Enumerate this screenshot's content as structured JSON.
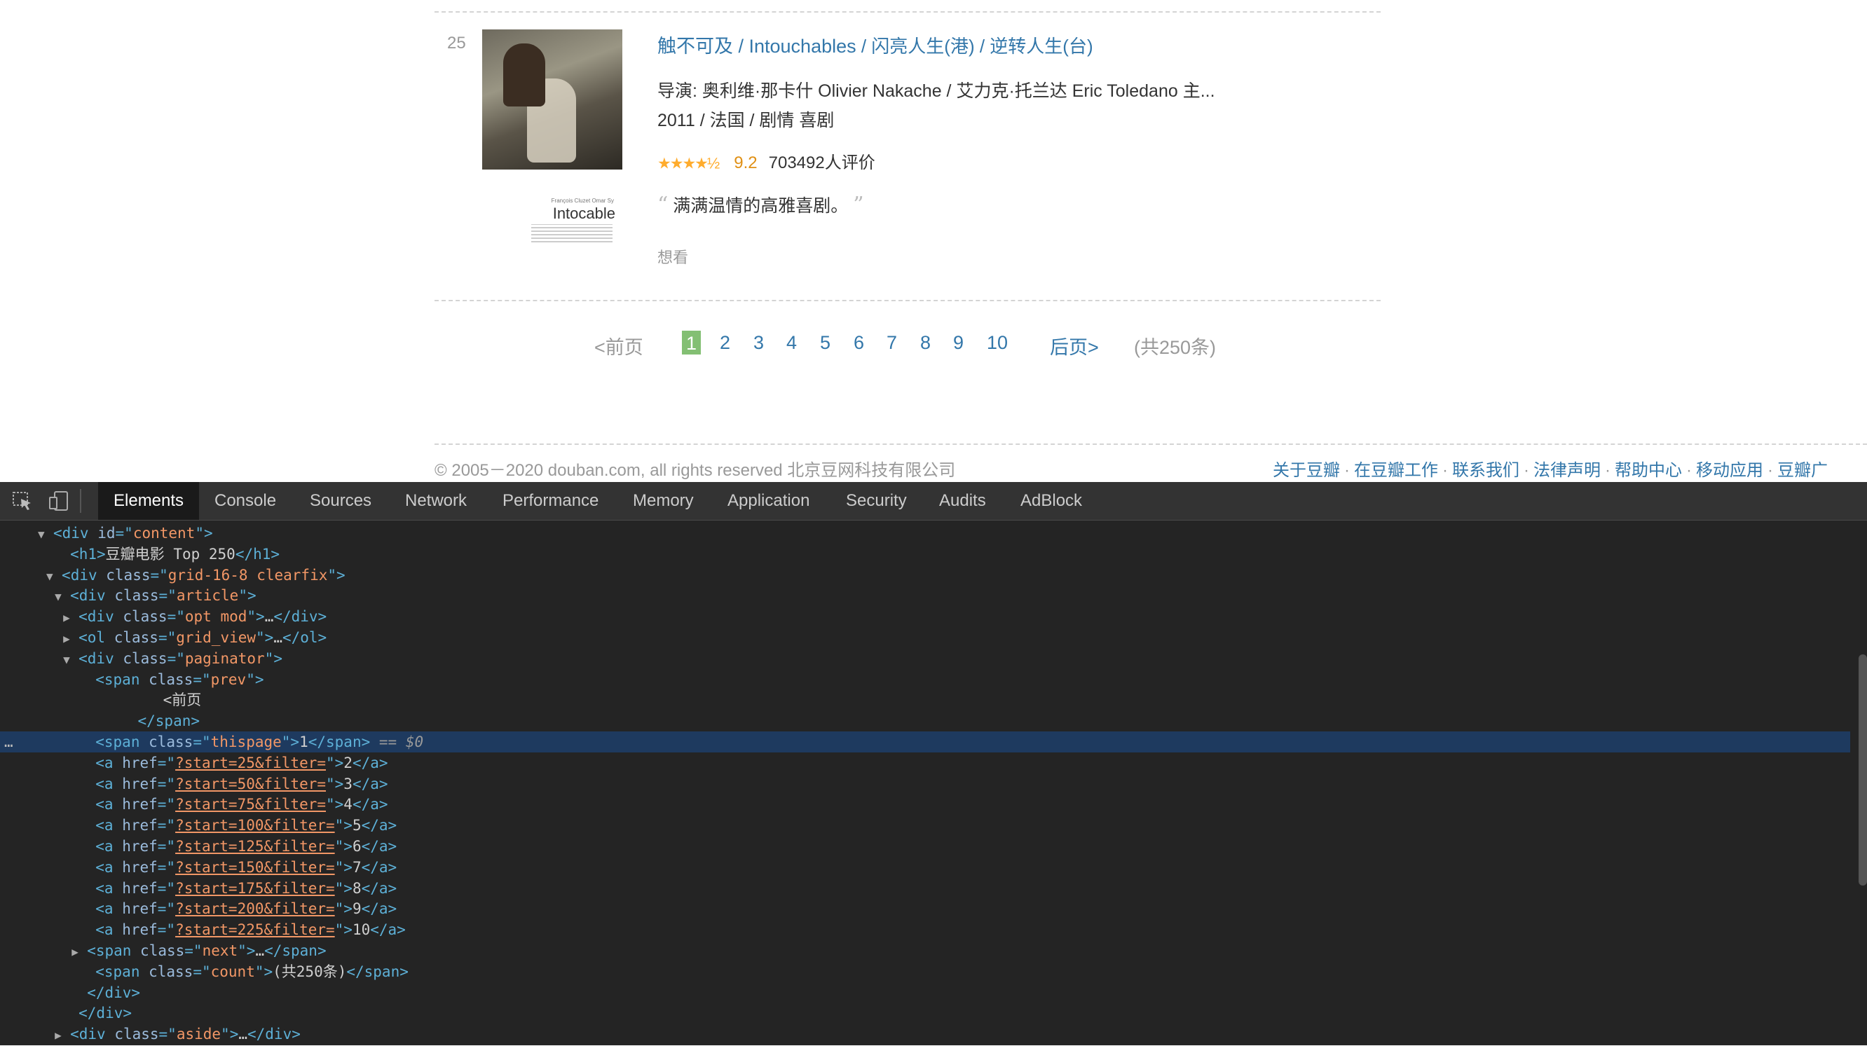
{
  "movie": {
    "rank": "25",
    "title": "触不可及",
    "title_original": " / Intouchables",
    "title_alt": " / 闪亮人生(港) / 逆转人生(台)",
    "director_line": "导演: 奥利维·那卡什 Olivier Nakache / 艾力克·托兰达 Eric Toledano   主...",
    "meta_line": "2011 / 法国 / 剧情 喜剧",
    "stars": "★★★★½",
    "rating": "9.2",
    "votes": "703492人评价",
    "quote": "满满温情的高雅喜剧。",
    "quote_open": "“",
    "quote_close": "”",
    "want": "想看",
    "poster_brand": "Intocable",
    "poster_credit": "François Cluzet  Omar Sy"
  },
  "paginator": {
    "prev": "<前页",
    "pages": [
      "1",
      "2",
      "3",
      "4",
      "5",
      "6",
      "7",
      "8",
      "9",
      "10"
    ],
    "next": "后页>",
    "count": "(共250条)"
  },
  "footer": {
    "copyright": "© 2005－2020 douban.com, all rights reserved 北京豆网科技有限公司",
    "links": [
      "关于豆瓣",
      "在豆瓣工作",
      "联系我们",
      "法律声明",
      "帮助中心",
      "移动应用",
      "豆瓣广"
    ]
  },
  "devtools": {
    "tabs": [
      "Elements",
      "Console",
      "Sources",
      "Network",
      "Performance",
      "Memory",
      "Application",
      "Security",
      "Audits",
      "AdBlock"
    ],
    "active_tab": "Elements",
    "lines": [
      {
        "indent": 4,
        "tri": "▼",
        "parts": [
          [
            "tg",
            "<div "
          ],
          [
            "at",
            "id"
          ],
          [
            "tg",
            "=\""
          ],
          [
            "av",
            "content"
          ],
          [
            "tg",
            "\">"
          ]
        ]
      },
      {
        "indent": 6,
        "tri": "",
        "parts": [
          [
            "tg",
            "<h1>"
          ],
          [
            "tx",
            "豆瓣电影 Top 250"
          ],
          [
            "tg",
            "</h1>"
          ]
        ]
      },
      {
        "indent": 5,
        "tri": "▼",
        "parts": [
          [
            "tg",
            "<div "
          ],
          [
            "at",
            "class"
          ],
          [
            "tg",
            "=\""
          ],
          [
            "av",
            "grid-16-8 clearfix"
          ],
          [
            "tg",
            "\">"
          ]
        ]
      },
      {
        "indent": 6,
        "tri": "▼",
        "parts": [
          [
            "tg",
            "<div "
          ],
          [
            "at",
            "class"
          ],
          [
            "tg",
            "=\""
          ],
          [
            "av",
            "article"
          ],
          [
            "tg",
            "\">"
          ]
        ]
      },
      {
        "indent": 7,
        "tri": "▶",
        "parts": [
          [
            "tg",
            "<div "
          ],
          [
            "at",
            "class"
          ],
          [
            "tg",
            "=\""
          ],
          [
            "av",
            "opt mod"
          ],
          [
            "tg",
            "\">"
          ],
          [
            "tx",
            "…"
          ],
          [
            "tg",
            "</div>"
          ]
        ]
      },
      {
        "indent": 7,
        "tri": "▶",
        "parts": [
          [
            "tg",
            "<ol "
          ],
          [
            "at",
            "class"
          ],
          [
            "tg",
            "=\""
          ],
          [
            "av",
            "grid_view"
          ],
          [
            "tg",
            "\">"
          ],
          [
            "tx",
            "…"
          ],
          [
            "tg",
            "</ol>"
          ]
        ]
      },
      {
        "indent": 7,
        "tri": "▼",
        "parts": [
          [
            "tg",
            "<div "
          ],
          [
            "at",
            "class"
          ],
          [
            "tg",
            "=\""
          ],
          [
            "av",
            "paginator"
          ],
          [
            "tg",
            "\">"
          ]
        ]
      },
      {
        "indent": 9,
        "tri": "",
        "parts": [
          [
            "tg",
            "<span "
          ],
          [
            "at",
            "class"
          ],
          [
            "tg",
            "=\""
          ],
          [
            "av",
            "prev"
          ],
          [
            "tg",
            "\">"
          ]
        ]
      },
      {
        "indent": 17,
        "tri": "",
        "parts": [
          [
            "tx",
            "<前页"
          ]
        ]
      },
      {
        "indent": 14,
        "tri": "",
        "parts": [
          [
            "tg",
            "</span>"
          ]
        ]
      },
      {
        "indent": 9,
        "tri": "",
        "sel": true,
        "parts": [
          [
            "tg",
            "<span "
          ],
          [
            "at",
            "class"
          ],
          [
            "tg",
            "=\""
          ],
          [
            "av",
            "thispage"
          ],
          [
            "tg",
            "\">"
          ],
          [
            "tx",
            "1"
          ],
          [
            "tg",
            "</span>"
          ],
          [
            "dim",
            " == $0"
          ]
        ]
      },
      {
        "indent": 9,
        "tri": "",
        "parts": [
          [
            "tg",
            "<a "
          ],
          [
            "at",
            "href"
          ],
          [
            "tg",
            "=\""
          ],
          [
            "av",
            "?start=25&filter="
          ],
          [
            "tg",
            "\">"
          ],
          [
            "tx",
            "2"
          ],
          [
            "tg",
            "</a>"
          ]
        ]
      },
      {
        "indent": 9,
        "tri": "",
        "parts": [
          [
            "tg",
            "<a "
          ],
          [
            "at",
            "href"
          ],
          [
            "tg",
            "=\""
          ],
          [
            "av",
            "?start=50&filter="
          ],
          [
            "tg",
            "\">"
          ],
          [
            "tx",
            "3"
          ],
          [
            "tg",
            "</a>"
          ]
        ]
      },
      {
        "indent": 9,
        "tri": "",
        "parts": [
          [
            "tg",
            "<a "
          ],
          [
            "at",
            "href"
          ],
          [
            "tg",
            "=\""
          ],
          [
            "av",
            "?start=75&filter="
          ],
          [
            "tg",
            "\">"
          ],
          [
            "tx",
            "4"
          ],
          [
            "tg",
            "</a>"
          ]
        ]
      },
      {
        "indent": 9,
        "tri": "",
        "parts": [
          [
            "tg",
            "<a "
          ],
          [
            "at",
            "href"
          ],
          [
            "tg",
            "=\""
          ],
          [
            "av",
            "?start=100&filter="
          ],
          [
            "tg",
            "\">"
          ],
          [
            "tx",
            "5"
          ],
          [
            "tg",
            "</a>"
          ]
        ]
      },
      {
        "indent": 9,
        "tri": "",
        "parts": [
          [
            "tg",
            "<a "
          ],
          [
            "at",
            "href"
          ],
          [
            "tg",
            "=\""
          ],
          [
            "av",
            "?start=125&filter="
          ],
          [
            "tg",
            "\">"
          ],
          [
            "tx",
            "6"
          ],
          [
            "tg",
            "</a>"
          ]
        ]
      },
      {
        "indent": 9,
        "tri": "",
        "parts": [
          [
            "tg",
            "<a "
          ],
          [
            "at",
            "href"
          ],
          [
            "tg",
            "=\""
          ],
          [
            "av",
            "?start=150&filter="
          ],
          [
            "tg",
            "\">"
          ],
          [
            "tx",
            "7"
          ],
          [
            "tg",
            "</a>"
          ]
        ]
      },
      {
        "indent": 9,
        "tri": "",
        "parts": [
          [
            "tg",
            "<a "
          ],
          [
            "at",
            "href"
          ],
          [
            "tg",
            "=\""
          ],
          [
            "av",
            "?start=175&filter="
          ],
          [
            "tg",
            "\">"
          ],
          [
            "tx",
            "8"
          ],
          [
            "tg",
            "</a>"
          ]
        ]
      },
      {
        "indent": 9,
        "tri": "",
        "parts": [
          [
            "tg",
            "<a "
          ],
          [
            "at",
            "href"
          ],
          [
            "tg",
            "=\""
          ],
          [
            "av",
            "?start=200&filter="
          ],
          [
            "tg",
            "\">"
          ],
          [
            "tx",
            "9"
          ],
          [
            "tg",
            "</a>"
          ]
        ]
      },
      {
        "indent": 9,
        "tri": "",
        "parts": [
          [
            "tg",
            "<a "
          ],
          [
            "at",
            "href"
          ],
          [
            "tg",
            "=\""
          ],
          [
            "av",
            "?start=225&filter="
          ],
          [
            "tg",
            "\">"
          ],
          [
            "tx",
            "10"
          ],
          [
            "tg",
            "</a>"
          ]
        ]
      },
      {
        "indent": 8,
        "tri": "▶",
        "parts": [
          [
            "tg",
            "<span "
          ],
          [
            "at",
            "class"
          ],
          [
            "tg",
            "=\""
          ],
          [
            "av",
            "next"
          ],
          [
            "tg",
            "\">"
          ],
          [
            "tx",
            "…"
          ],
          [
            "tg",
            "</span>"
          ]
        ]
      },
      {
        "indent": 9,
        "tri": "",
        "parts": [
          [
            "tg",
            "<span "
          ],
          [
            "at",
            "class"
          ],
          [
            "tg",
            "=\""
          ],
          [
            "av",
            "count"
          ],
          [
            "tg",
            "\">"
          ],
          [
            "tx",
            "(共250条)"
          ],
          [
            "tg",
            "</span>"
          ]
        ]
      },
      {
        "indent": 8,
        "tri": "",
        "parts": [
          [
            "tg",
            "</div>"
          ]
        ]
      },
      {
        "indent": 7,
        "tri": "",
        "parts": [
          [
            "tg",
            "</div>"
          ]
        ]
      },
      {
        "indent": 6,
        "tri": "▶",
        "parts": [
          [
            "tg",
            "<div "
          ],
          [
            "at",
            "class"
          ],
          [
            "tg",
            "=\""
          ],
          [
            "av",
            "aside"
          ],
          [
            "tg",
            "\">"
          ],
          [
            "tx",
            "…"
          ],
          [
            "tg",
            "</div>"
          ]
        ]
      }
    ]
  }
}
